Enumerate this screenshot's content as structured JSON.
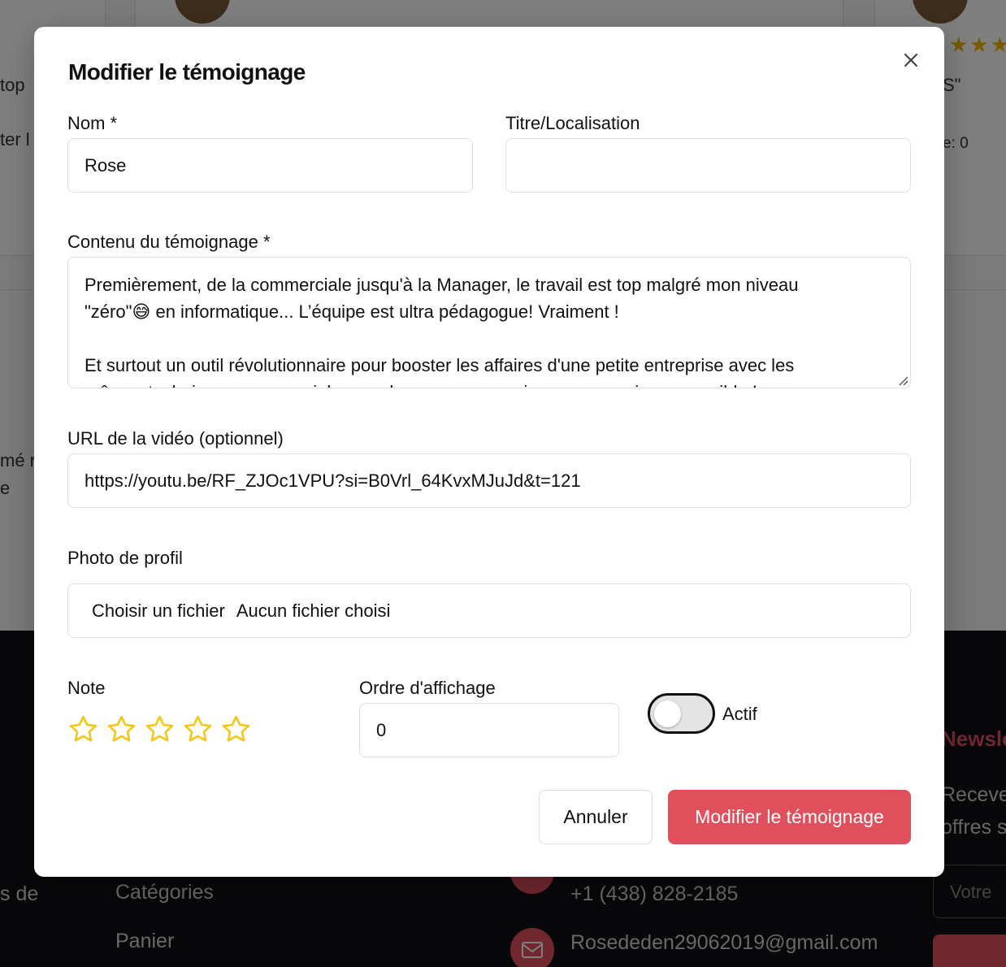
{
  "background": {
    "cards_text": {
      "left_top": "top",
      "left_mid": "ter l",
      "right_quote": "S\"",
      "right_note": "e: 0",
      "left_lower1": "mé r",
      "left_lower2": "e"
    },
    "stars": "★★★",
    "footer": {
      "left_text": "s de",
      "links": [
        "Catégories",
        "Panier"
      ],
      "phone": "+1 (438) 828-2185",
      "email": "Rosededen29062019@gmail.com",
      "newsletter_title": "Newsle",
      "newsletter_text_1": "Recevez",
      "newsletter_text_2": "offres s",
      "newsletter_input_placeholder": "Votre"
    }
  },
  "modal": {
    "title": "Modifier le témoignage",
    "fields": {
      "name": {
        "label": "Nom *",
        "value": "Rose"
      },
      "title_location": {
        "label": "Titre/Localisation",
        "value": ""
      },
      "content": {
        "label": "Contenu du témoignage *",
        "lines": [
          "Premièrement, de la commerciale jusqu'à la Manager, le travail est top malgré mon niveau",
          "\"zéro\"😅 en informatique... L’équipe est ultra pédagogue! Vraiment !",
          "",
          "Et surtout un outil révolutionnaire pour booster les affaires d'une petite entreprise avec les",
          "mêmes techniques commerciales que les grosses enseignes, en version accessible !"
        ]
      },
      "video_url": {
        "label": "URL de la vidéo (optionnel)",
        "value": "https://youtu.be/RF_ZJOc1VPU?si=B0Vrl_64KvxMJuJd&t=121"
      },
      "photo": {
        "label": "Photo de profil",
        "button": "Choisir un fichier",
        "status": "Aucun fichier choisi"
      },
      "rating": {
        "label": "Note",
        "value": 0,
        "max": 5
      },
      "display_order": {
        "label": "Ordre d'affichage",
        "value": "0"
      },
      "active": {
        "label": "Actif",
        "checked": false
      }
    },
    "buttons": {
      "cancel": "Annuler",
      "submit": "Modifier le témoignage"
    }
  },
  "colors": {
    "accent": "#e0505c",
    "star": "#f5c518",
    "footer_bg": "#101014"
  }
}
